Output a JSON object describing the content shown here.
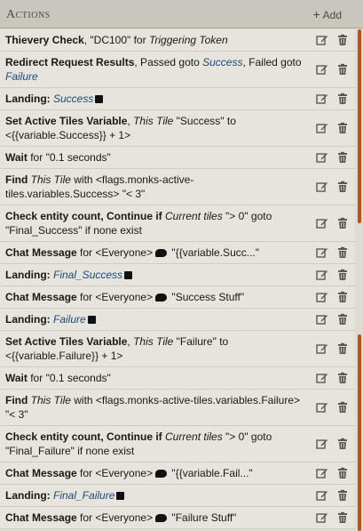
{
  "header": {
    "title": "Actions",
    "add_label": "Add"
  },
  "colors": {
    "accent_scroll": "#b5531c",
    "link_blue": "#1d4a7a"
  },
  "rows": [
    {
      "parts": [
        "Thievery Check",
        ", \"DC100\" for ",
        "Triggering Token"
      ]
    },
    {
      "parts": [
        "Redirect Request Results",
        ", Passed goto ",
        "Success",
        ", Failed goto ",
        "Failure"
      ]
    },
    {
      "parts": [
        "Landing: ",
        "Success"
      ]
    },
    {
      "parts": [
        "Set Active Tiles Variable",
        ", ",
        "This Tile",
        " \"Success\" to <{{variable.Success}} + 1>"
      ]
    },
    {
      "parts": [
        "Wait",
        " for \"0.1 seconds\""
      ]
    },
    {
      "parts": [
        "Find",
        " ",
        "This Tile",
        " with <flags.monks-active-tiles.variables.Success> \"< 3\""
      ]
    },
    {
      "parts": [
        "Check entity count, Continue if",
        " ",
        "Current tiles",
        " \"> 0\" goto \"Final_Success\" if none exist"
      ]
    },
    {
      "parts": [
        "Chat Message",
        " for <Everyone>",
        " \"{{variable.Succ...\""
      ]
    },
    {
      "parts": [
        "Landing: ",
        "Final_Success"
      ]
    },
    {
      "parts": [
        "Chat Message",
        " for <Everyone>",
        " \"Success Stuff\""
      ]
    },
    {
      "parts": [
        "Landing: ",
        "Failure"
      ]
    },
    {
      "parts": [
        "Set Active Tiles Variable",
        ", ",
        "This Tile",
        " \"Failure\" to <{{variable.Failure}} + 1>"
      ]
    },
    {
      "parts": [
        "Wait",
        " for \"0.1 seconds\""
      ]
    },
    {
      "parts": [
        "Find",
        " ",
        "This Tile",
        " with <flags.monks-active-tiles.variables.Failure> \"< 3\""
      ]
    },
    {
      "parts": [
        "Check entity count, Continue if",
        " ",
        "Current tiles",
        " \"> 0\" goto \"Final_Failure\" if none exist"
      ]
    },
    {
      "parts": [
        "Chat Message",
        " for <Everyone>",
        " \"{{variable.Fail...\""
      ]
    },
    {
      "parts": [
        "Landing: ",
        "Final_Failure"
      ]
    },
    {
      "parts": [
        "Chat Message",
        " for <Everyone>",
        " \"Failure Stuff\""
      ]
    }
  ]
}
